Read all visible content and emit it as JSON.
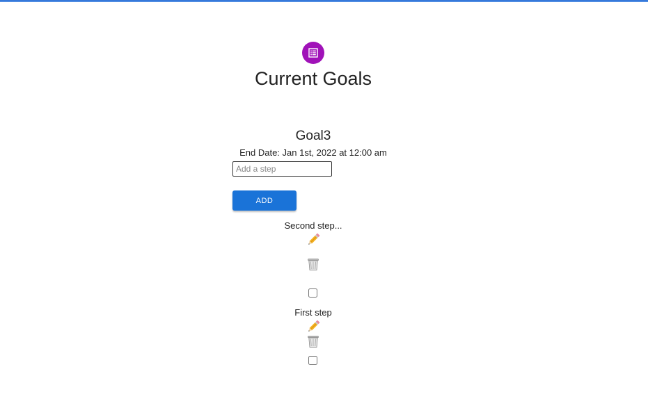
{
  "header": {
    "title": "Current Goals",
    "icon": "list-alt-icon",
    "icon_color": "#a012b8",
    "accent_bar_color": "#2a6fd6"
  },
  "goal": {
    "name": "Goal3",
    "end_date": "End Date: Jan 1st, 2022 at 12:00 am"
  },
  "step_form": {
    "input_placeholder": "Add a step",
    "input_value": "",
    "add_label": "ADD",
    "button_color": "#1a73d8"
  },
  "steps": [
    {
      "text": "Second step...",
      "completed": false,
      "edit_icon": "pencil-icon",
      "delete_icon": "trash-icon"
    },
    {
      "text": "First step",
      "completed": false,
      "edit_icon": "pencil-icon",
      "delete_icon": "trash-icon"
    }
  ]
}
